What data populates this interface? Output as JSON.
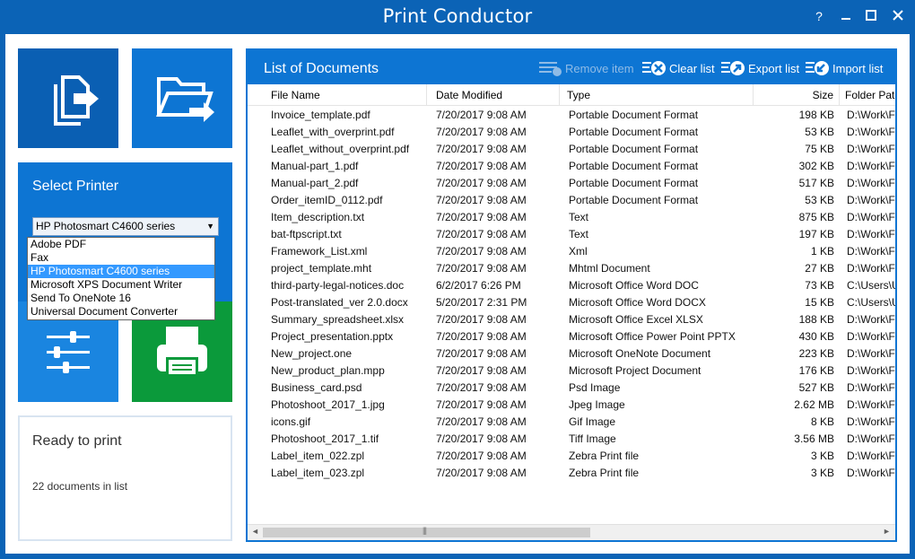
{
  "window": {
    "title": "Print Conductor",
    "help_label": "?"
  },
  "printer": {
    "section_title": "Select Printer",
    "selected": "HP Photosmart C4600 series",
    "options": [
      "Adobe PDF",
      "Fax",
      "HP Photosmart C4600 series",
      "Microsoft XPS Document Writer",
      "Send To OneNote 16",
      "Universal Document Converter"
    ]
  },
  "status": {
    "title": "Ready to print",
    "count_text": "22 documents in list"
  },
  "list": {
    "title": "List of Documents",
    "toolbar": {
      "remove_label": "Remove item",
      "clear_label": "Clear list",
      "export_label": "Export list",
      "import_label": "Import list"
    },
    "columns": [
      "File Name",
      "Date Modified",
      "Type",
      "Size",
      "Folder Pat"
    ],
    "rows": [
      [
        "Invoice_template.pdf",
        "7/20/2017 9:08 AM",
        "Portable Document Format",
        "198 KB",
        "D:\\Work\\F"
      ],
      [
        "Leaflet_with_overprint.pdf",
        "7/20/2017 9:08 AM",
        "Portable Document Format",
        "53 KB",
        "D:\\Work\\F"
      ],
      [
        "Leaflet_without_overprint.pdf",
        "7/20/2017 9:08 AM",
        "Portable Document Format",
        "75 KB",
        "D:\\Work\\F"
      ],
      [
        "Manual-part_1.pdf",
        "7/20/2017 9:08 AM",
        "Portable Document Format",
        "302 KB",
        "D:\\Work\\F"
      ],
      [
        "Manual-part_2.pdf",
        "7/20/2017 9:08 AM",
        "Portable Document Format",
        "517 KB",
        "D:\\Work\\F"
      ],
      [
        "Order_itemID_0112.pdf",
        "7/20/2017 9:08 AM",
        "Portable Document Format",
        "53 KB",
        "D:\\Work\\F"
      ],
      [
        "Item_description.txt",
        "7/20/2017 9:08 AM",
        "Text",
        "875 KB",
        "D:\\Work\\F"
      ],
      [
        "bat-ftpscript.txt",
        "7/20/2017 9:08 AM",
        "Text",
        "197 KB",
        "D:\\Work\\F"
      ],
      [
        "Framework_List.xml",
        "7/20/2017 9:08 AM",
        "Xml",
        "1 KB",
        "D:\\Work\\F"
      ],
      [
        "project_template.mht",
        "7/20/2017 9:08 AM",
        "Mhtml Document",
        "27 KB",
        "D:\\Work\\F"
      ],
      [
        "third-party-legal-notices.doc",
        "6/2/2017 6:26 PM",
        "Microsoft Office Word DOC",
        "73 KB",
        "C:\\Users\\U"
      ],
      [
        "Post-translated_ver 2.0.docx",
        "5/20/2017 2:31 PM",
        "Microsoft Office Word DOCX",
        "15 KB",
        "C:\\Users\\U"
      ],
      [
        "Summary_spreadsheet.xlsx",
        "7/20/2017 9:08 AM",
        "Microsoft Office Excel XLSX",
        "188 KB",
        "D:\\Work\\F"
      ],
      [
        "Project_presentation.pptx",
        "7/20/2017 9:08 AM",
        "Microsoft Office Power Point PPTX",
        "430 KB",
        "D:\\Work\\F"
      ],
      [
        "New_project.one",
        "7/20/2017 9:08 AM",
        "Microsoft OneNote Document",
        "223 KB",
        "D:\\Work\\F"
      ],
      [
        "New_product_plan.mpp",
        "7/20/2017 9:08 AM",
        "Microsoft Project Document",
        "176 KB",
        "D:\\Work\\F"
      ],
      [
        "Business_card.psd",
        "7/20/2017 9:08 AM",
        "Psd Image",
        "527 KB",
        "D:\\Work\\F"
      ],
      [
        "Photoshoot_2017_1.jpg",
        "7/20/2017 9:08 AM",
        "Jpeg Image",
        "2.62 MB",
        "D:\\Work\\F"
      ],
      [
        "icons.gif",
        "7/20/2017 9:08 AM",
        "Gif Image",
        "8 KB",
        "D:\\Work\\F"
      ],
      [
        "Photoshoot_2017_1.tif",
        "7/20/2017 9:08 AM",
        "Tiff Image",
        "3.56 MB",
        "D:\\Work\\F"
      ],
      [
        "Label_item_022.zpl",
        "7/20/2017 9:08 AM",
        "Zebra Print file",
        "3 KB",
        "D:\\Work\\F"
      ],
      [
        "Label_item_023.zpl",
        "7/20/2017 9:08 AM",
        "Zebra Print file",
        "3 KB",
        "D:\\Work\\F"
      ]
    ]
  },
  "colors": {
    "titlebar": "#0b63b6",
    "tile_blue": "#0d75d3",
    "tile_dark_blue": "#0a5fb3",
    "tile_green": "#0b9a3b",
    "selection": "#3399ff"
  },
  "icons": {
    "add_files": "add-files-icon",
    "add_folder": "add-folder-icon",
    "settings": "sliders-icon",
    "print": "printer-icon"
  }
}
